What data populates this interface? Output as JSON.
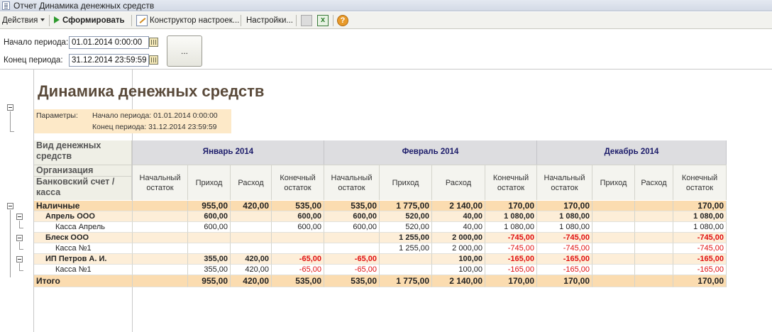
{
  "window": {
    "title": "Отчет  Динамика денежных средств"
  },
  "toolbar": {
    "actions_label": "Действия",
    "generate_label": "Сформировать",
    "constructor_label": "Конструктор настроек...",
    "settings_label": "Настройки...",
    "help_label": "?"
  },
  "period": {
    "start_label": "Начало периода:",
    "start_value": "01.01.2014  0:00:00",
    "end_label": "Конец периода:",
    "end_value": "31.12.2014 23:59:59",
    "more_button": "..."
  },
  "report": {
    "title": "Динамика денежных средств",
    "params_label": "Параметры:",
    "param1": "Начало периода: 01.01.2014 0:00:00",
    "param2": "Конец периода: 31.12.2014 23:59:59",
    "side_headers": [
      "Вид денежных средств",
      "Организация",
      "Банковский счет / касса"
    ],
    "months": [
      "Январь 2014",
      "Февраль 2014",
      "Декабрь 2014"
    ],
    "subcols": [
      "Начальный остаток",
      "Приход",
      "Расход",
      "Конечный остаток"
    ],
    "rows": [
      {
        "label": "Наличные",
        "level": "cash",
        "values": [
          "",
          "955,00",
          "420,00",
          "535,00",
          "535,00",
          "1 775,00",
          "2 140,00",
          "170,00",
          "170,00",
          "",
          "",
          "170,00"
        ]
      },
      {
        "label": "Апрель ООО",
        "level": "org",
        "values": [
          "",
          "600,00",
          "",
          "600,00",
          "600,00",
          "520,00",
          "40,00",
          "1 080,00",
          "1 080,00",
          "",
          "",
          "1 080,00"
        ]
      },
      {
        "label": "Касса Апрель",
        "level": "acc",
        "values": [
          "",
          "600,00",
          "",
          "600,00",
          "600,00",
          "520,00",
          "40,00",
          "1 080,00",
          "1 080,00",
          "",
          "",
          "1 080,00"
        ]
      },
      {
        "label": "Блеск ООО",
        "level": "org",
        "values": [
          "",
          "",
          "",
          "",
          "",
          "1 255,00",
          "2 000,00",
          "-745,00",
          "-745,00",
          "",
          "",
          "-745,00"
        ]
      },
      {
        "label": "Касса №1",
        "level": "acc",
        "values": [
          "",
          "",
          "",
          "",
          "",
          "1 255,00",
          "2 000,00",
          "-745,00",
          "-745,00",
          "",
          "",
          "-745,00"
        ]
      },
      {
        "label": "ИП Петров А. И.",
        "level": "org",
        "values": [
          "",
          "355,00",
          "420,00",
          "-65,00",
          "-65,00",
          "",
          "100,00",
          "-165,00",
          "-165,00",
          "",
          "",
          "-165,00"
        ]
      },
      {
        "label": "Касса №1",
        "level": "acc",
        "values": [
          "",
          "355,00",
          "420,00",
          "-65,00",
          "-65,00",
          "",
          "100,00",
          "-165,00",
          "-165,00",
          "",
          "",
          "-165,00"
        ]
      },
      {
        "label": "Итого",
        "level": "total",
        "values": [
          "",
          "955,00",
          "420,00",
          "535,00",
          "535,00",
          "1 775,00",
          "2 140,00",
          "170,00",
          "170,00",
          "",
          "",
          "170,00"
        ]
      }
    ]
  }
}
